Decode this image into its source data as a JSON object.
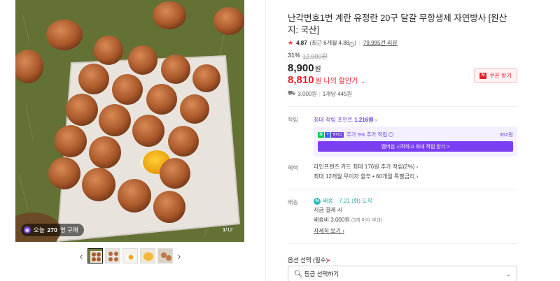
{
  "gallery": {
    "today_count": "270",
    "today_prefix": "오늘 ",
    "today_suffix": "명 구매",
    "counter_current": "1",
    "counter_total": "/12",
    "prev_icon": "chevron-left-icon",
    "next_icon": "chevron-right-icon"
  },
  "product": {
    "title": "난각번호1번 계란 유정란 20구 달걀 무항생제 자연방사 [원산지: 국산]",
    "rating": "4.87",
    "rating_recent": "(최근 6개월 4.88",
    "rating_recent_close": ")",
    "review_count": "79,995건 리뷰",
    "discount_rate": "31%",
    "original_price": "12,900원",
    "price": "8,900",
    "price_unit": "원",
    "my_price": "8,810",
    "my_price_label": "원 나의 할인가",
    "coupon_label": "쿠폰 받기",
    "shipping_fee": "3,000원",
    "per_unit": "1개당 445원"
  },
  "points": {
    "label": "적립",
    "max_point_prefix": "최대 적립 포인트 ",
    "max_point_value": "1,216원",
    "np_text": "추가 5% 추가 적립",
    "np_text_a": "추가 5% 추가 적립",
    "np_amount": "352원",
    "np_button": "멤버십 시작하고 최대 적립 받기 >"
  },
  "benefits": {
    "label": "혜택",
    "line1": "라인프렌즈 카드 최대 176원 추가 적립(2%)",
    "line2": "최대 12개월 무이자 할부 • 60개월 특별금리"
  },
  "delivery": {
    "label": "배송",
    "badge": "배송",
    "arrival": "7.21 (화) 도착",
    "line1": "지금 결제 시",
    "line2": "배송비 3,000원",
    "line2_note": "(3개 마다 부과)",
    "more": "자세히 보기"
  },
  "option": {
    "label": "옵션 선택 (필수)",
    "required_mark": "•",
    "select_text": "등급 선택하기"
  },
  "colors": {
    "accent_red": "#e8202a",
    "membership_purple": "#6b3fd8",
    "delivery_teal": "#2ba7a6"
  }
}
